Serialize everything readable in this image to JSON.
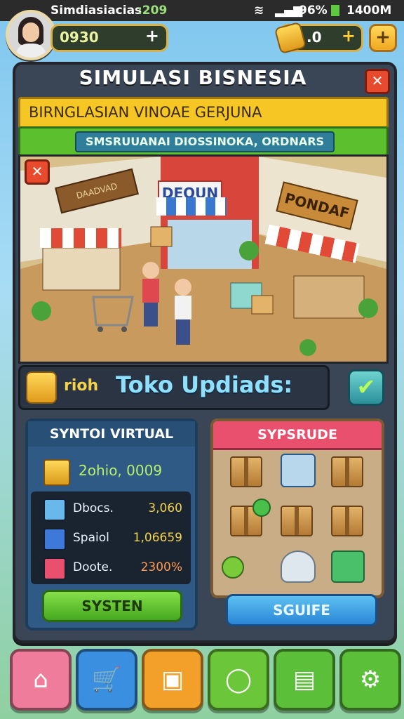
{
  "status_bar": {
    "app_label": "Simdiasiacias",
    "app_value": ":209",
    "battery": "96%",
    "time": "1400M"
  },
  "hud": {
    "currency_left": "0930",
    "currency_right": ".0",
    "plus": "+"
  },
  "panel": {
    "title": "SIMULASI BISNESIA",
    "banner_yellow": "BIRNGLASIAN VINOAE GERJUNA",
    "banner_green": "SMSRUUANAI DIOSSINOKA, ORDNARS",
    "close": "✕"
  },
  "shop_scene": {
    "sign_left": "DAADVAD",
    "sign_center": "DEOUN",
    "sign_right": "PONDAF"
  },
  "update_bar": {
    "label": "rioh",
    "title": "Toko Updiads:"
  },
  "left_card": {
    "title": "SYNTOI VIRTUAL",
    "total": "2ohio, 0009",
    "rows": [
      {
        "label": "Dbocs.",
        "value": "3,060",
        "color": "#68b8ec"
      },
      {
        "label": "Spaiol",
        "value": "1,06659",
        "color": "#3e78d8"
      },
      {
        "label": "Doote.",
        "value": "2300%",
        "color": "#e8506e"
      }
    ],
    "button": "SYSTEN"
  },
  "right_card": {
    "title": "SYPSRUDE",
    "button": "SGUIFE"
  },
  "nav": [
    {
      "name": "home",
      "color": "#ef7c9a",
      "icon": "⌂"
    },
    {
      "name": "cart",
      "color": "#3b8fe0",
      "icon": "🛒"
    },
    {
      "name": "box",
      "color": "#f2a02a",
      "icon": "▣"
    },
    {
      "name": "chat",
      "color": "#6cc63a",
      "icon": "◯"
    },
    {
      "name": "register",
      "color": "#5cbf3a",
      "icon": "▤"
    },
    {
      "name": "settings",
      "color": "#5cbf3a",
      "icon": "⚙"
    }
  ]
}
